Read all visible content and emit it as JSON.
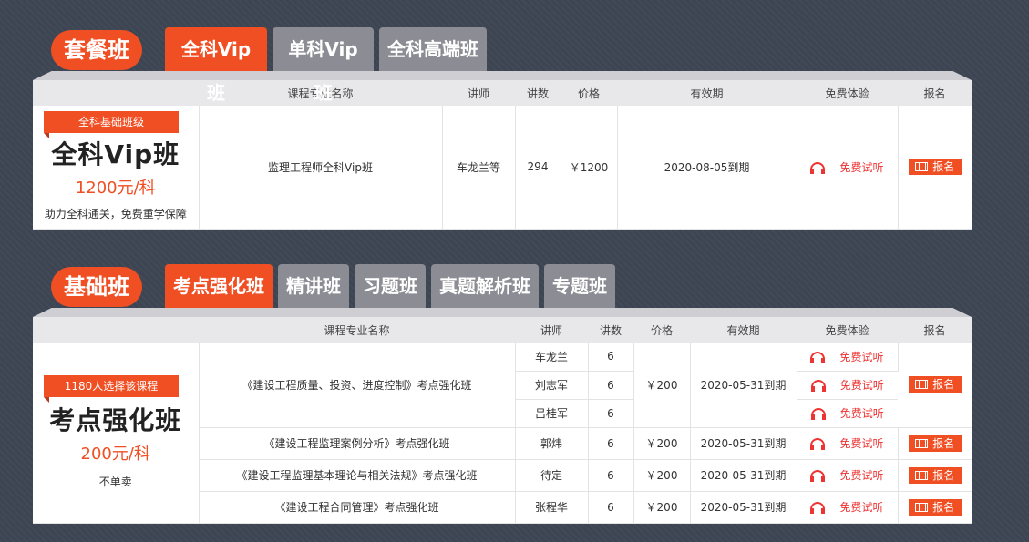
{
  "columns": {
    "name": "课程专业名称",
    "teacher": "讲师",
    "lessons": "讲数",
    "price": "价格",
    "validity": "有效期",
    "trial": "免费体验",
    "signup": "报名"
  },
  "section1": {
    "label": "套餐班",
    "tabs": [
      "全科Vip班",
      "单科Vip班",
      "全科高端班"
    ],
    "promo": {
      "flag": "全科基础班级",
      "title": "全科Vip班",
      "price": "1200元/科",
      "desc": "助力全科通关，免费重学保障"
    },
    "row": {
      "name": "监理工程师全科Vip班",
      "teacher": "车龙兰等",
      "lessons": "294",
      "price": "￥1200",
      "validity": "2020-08-05到期",
      "trial": "免费试听",
      "signup": "报名"
    }
  },
  "section2": {
    "label": "基础班",
    "tabs": [
      "考点强化班",
      "精讲班",
      "习题班",
      "真题解析班",
      "专题班"
    ],
    "promo": {
      "flag": "1180人选择该课程",
      "title": "考点强化班",
      "price": "200元/科",
      "desc": "不单卖"
    },
    "group": {
      "name": "《建设工程质量、投资、进度控制》考点强化班",
      "teachers": [
        {
          "teacher": "车龙兰",
          "lessons": "6",
          "trial": "免费试听"
        },
        {
          "teacher": "刘志军",
          "lessons": "6",
          "trial": "免费试听"
        },
        {
          "teacher": "吕桂军",
          "lessons": "6",
          "trial": "免费试听"
        }
      ],
      "price": "￥200",
      "validity": "2020-05-31到期",
      "signup": "报名"
    },
    "rows": [
      {
        "name": "《建设工程监理案例分析》考点强化班",
        "teacher": "郭炜",
        "lessons": "6",
        "price": "￥200",
        "validity": "2020-05-31到期",
        "trial": "免费试听",
        "signup": "报名"
      },
      {
        "name": "《建设工程监理基本理论与相关法规》考点强化班",
        "teacher": "待定",
        "lessons": "6",
        "price": "￥200",
        "validity": "2020-05-31到期",
        "trial": "免费试听",
        "signup": "报名"
      },
      {
        "name": "《建设工程合同管理》考点强化班",
        "teacher": "张程华",
        "lessons": "6",
        "price": "￥200",
        "validity": "2020-05-31到期",
        "trial": "免费试听",
        "signup": "报名"
      }
    ]
  }
}
